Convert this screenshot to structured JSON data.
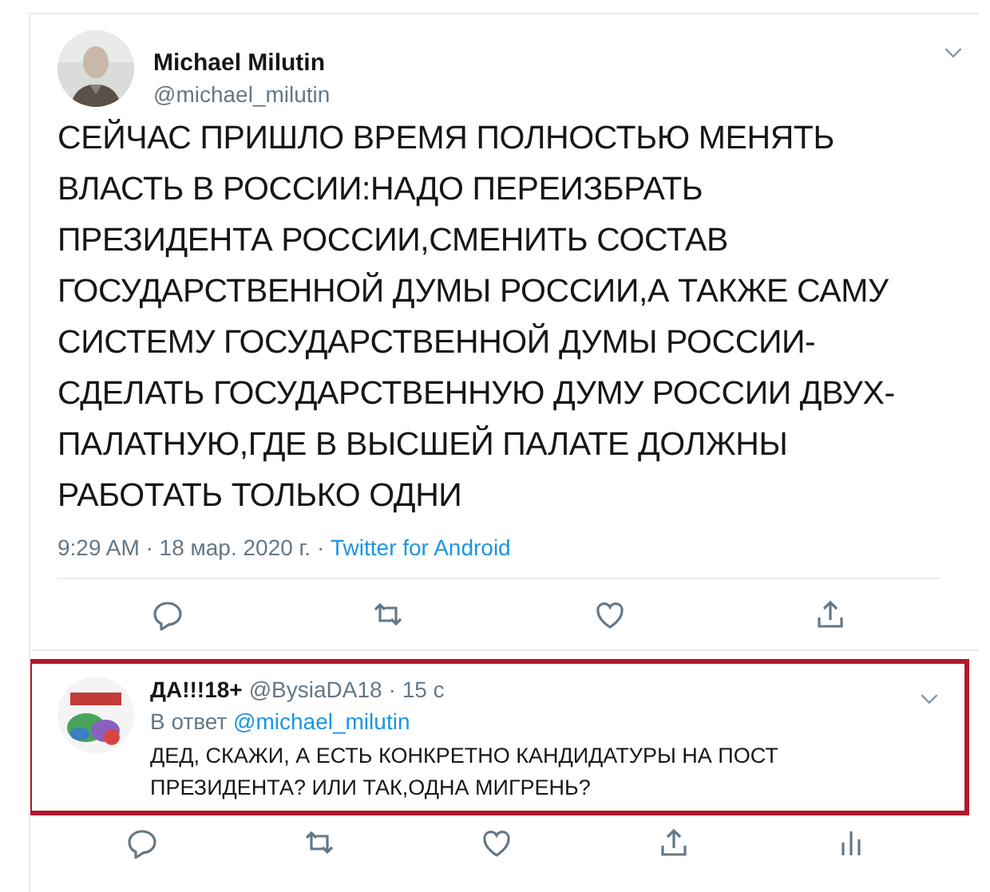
{
  "tweet": {
    "name": "Michael Milutin",
    "handle": "@michael_milutin",
    "text": "СЕЙЧАС ПРИШЛО ВРЕМЯ ПОЛНОСТЬЮ МЕНЯТЬ\nВЛАСТЬ В РОССИИ:НАДО ПЕРЕИЗБРАТЬ\nПРЕЗИДЕНТА РОССИИ,СМЕНИТЬ СОСТАВ\nГОСУДАРСТВЕННОЙ ДУМЫ РОССИИ,А ТАКЖЕ САМУ\nСИСТЕМУ ГОСУДАРСТВЕННОЙ ДУМЫ РОССИИ-\nСДЕЛАТЬ ГОСУДАРСТВЕННУЮ ДУМУ РОССИИ ДВУХ-\nПАЛАТНУЮ,ГДЕ В ВЫСШЕЙ ПАЛАТЕ ДОЛЖНЫ\nРАБОТАТЬ ТОЛЬКО ОДНИ",
    "meta": "9:29 AM · 18 мар. 2020 г. · ",
    "source": "Twitter for Android",
    "actions": [
      {
        "kind": "reply"
      },
      {
        "kind": "retweet"
      },
      {
        "kind": "like"
      },
      {
        "kind": "share"
      }
    ]
  },
  "reply": {
    "name": "ДА!!!18+",
    "handle": "@BysiaDA18",
    "time": "· 15 с",
    "in_reply_prefix": "В ответ ",
    "in_reply_to": "@michael_milutin",
    "text": "ДЕД, СКАЖИ, А ЕСТЬ КОНКРЕТНО КАНДИДАТУРЫ НА ПОСТ\nПРЕЗИДЕНТА? ИЛИ ТАК,ОДНА МИГРЕНЬ?",
    "highlighted": true,
    "actions": [
      {
        "kind": "reply"
      },
      {
        "kind": "retweet"
      },
      {
        "kind": "like"
      },
      {
        "kind": "share"
      },
      {
        "kind": "analytics"
      }
    ]
  }
}
